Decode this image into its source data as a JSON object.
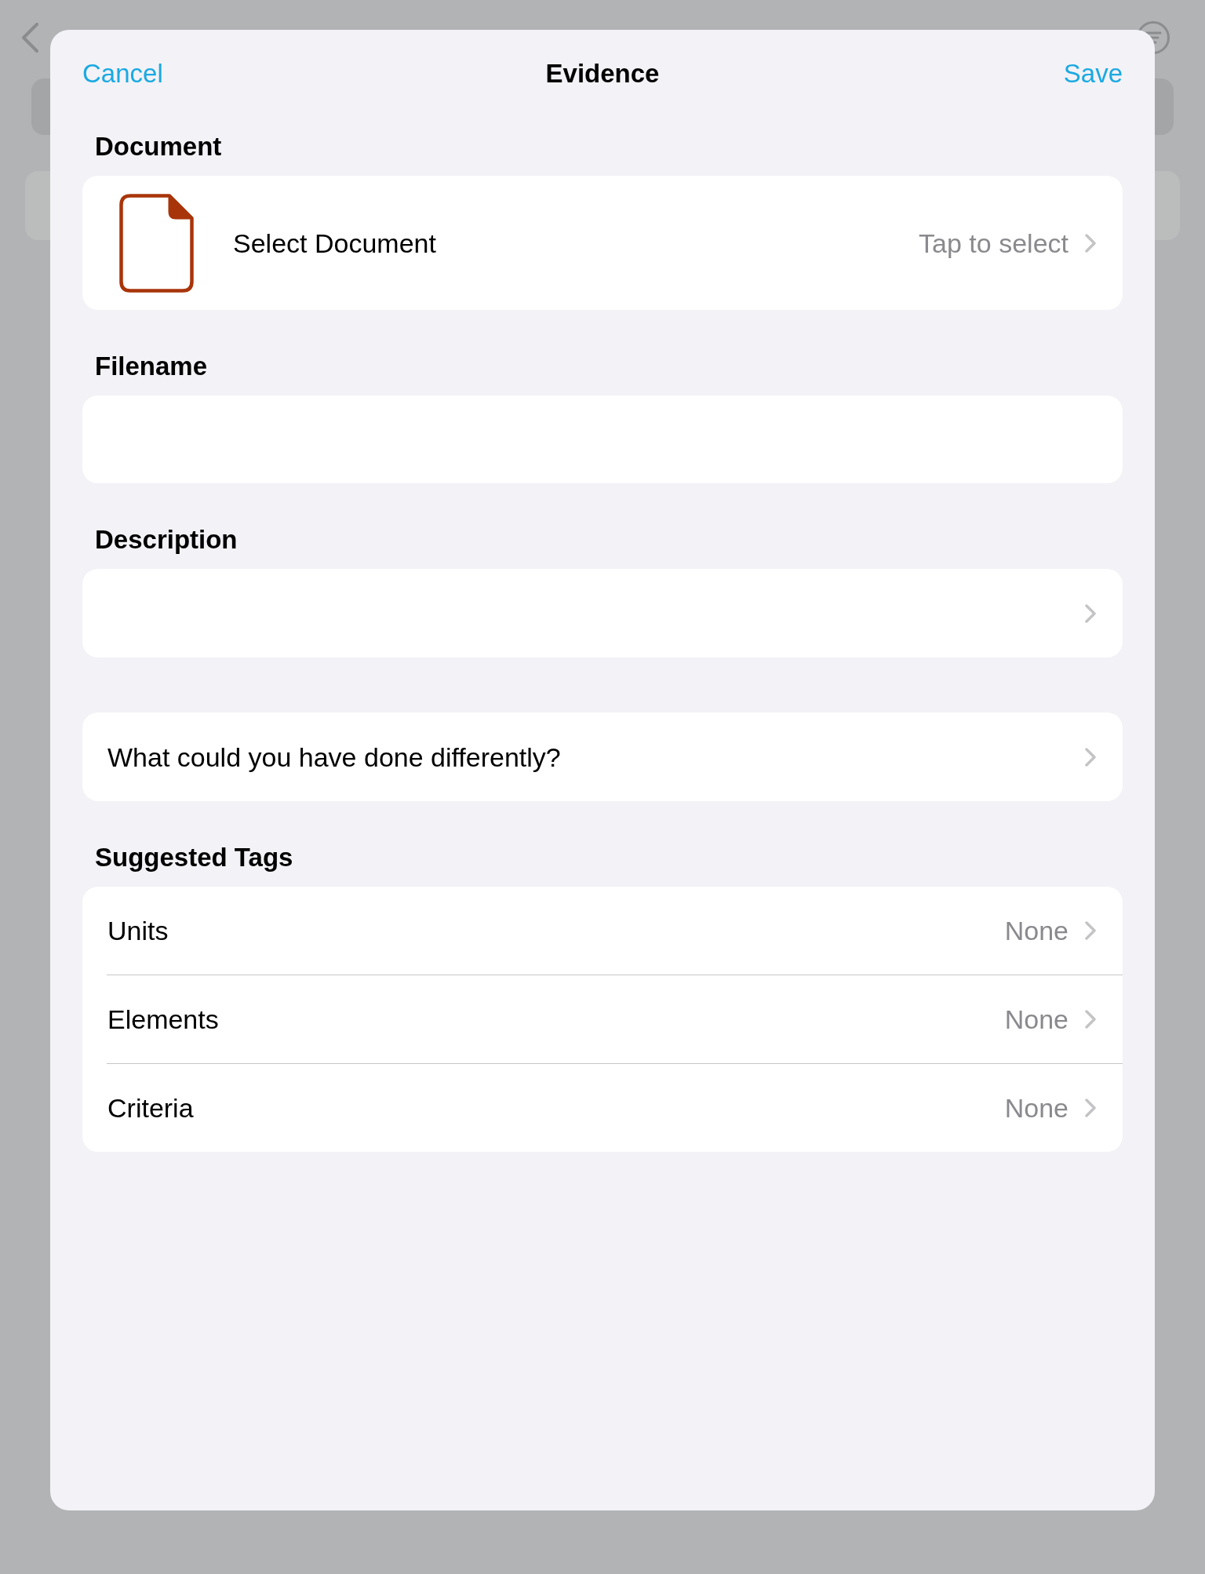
{
  "nav_bar": {
    "cancel": "Cancel",
    "title": "Evidence",
    "save": "Save"
  },
  "sections": [
    {
      "kind": "document",
      "header": "Document",
      "label": "Select Document",
      "value": "Tap to select"
    },
    {
      "kind": "text_field",
      "header": "Filename"
    },
    {
      "kind": "link_field",
      "header": "Description"
    },
    {
      "kind": "link_row",
      "label": "What could you have done differently?"
    },
    {
      "kind": "list",
      "header": "Suggested Tags",
      "rows": [
        {
          "label": "Units",
          "value": "None"
        },
        {
          "label": "Elements",
          "value": "None"
        },
        {
          "label": "Criteria",
          "value": "None"
        }
      ]
    }
  ]
}
